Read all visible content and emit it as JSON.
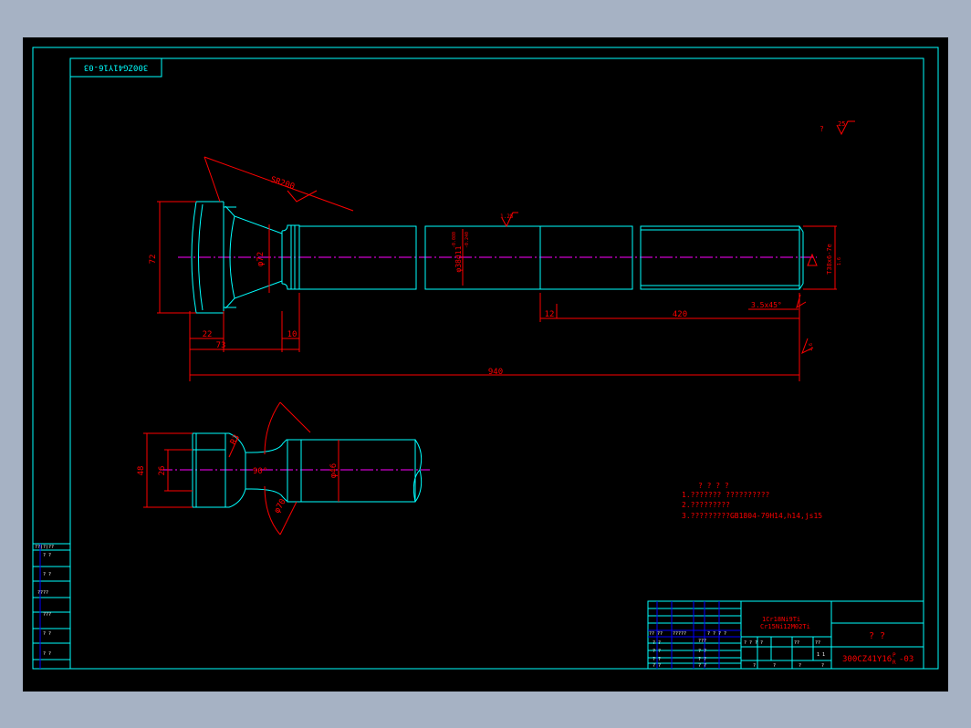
{
  "colors": {
    "outline": "#00ffff",
    "dimension": "#ff0000",
    "centerline": "#ff00ff",
    "note": "#ff0000",
    "text": "#ffffff",
    "border_blue": "#0000ff"
  },
  "drawing": {
    "code_box": "300ZG41Y16-03",
    "roughness_general": "25",
    "roughness_general_prefix": "?",
    "dims": {
      "sr200": "SR200",
      "d72_head": "72",
      "phi72": "φ72",
      "d22": "22",
      "d73": "73",
      "d10": "10",
      "d940": "940",
      "d12": "12",
      "d420": "420",
      "chamfer": "3.5x45°",
      "phi38": "φ38d11",
      "tol_upper": "-0.080",
      "tol_lower": "-0.240",
      "thread": "T38x6-7e",
      "rough_160": "1.25",
      "rough_small_a": "1.6",
      "rough_small_b": "1.6",
      "d48": "48",
      "d26": "26",
      "r3": "R3",
      "angle90": "90°",
      "phi46": "φ46",
      "phi70": "φ70"
    },
    "notes_title": "? ? ? ?",
    "notes": [
      "1.??????? ??????????",
      "2.?????????",
      "3.?????????GB1804-79H14,h14,js15"
    ]
  },
  "left_panel": {
    "rows": [
      "??(?)??",
      "? ?",
      "? ?",
      "????",
      "???",
      "? ?",
      "? ?"
    ]
  },
  "title_block": {
    "material_line1": "1Cr18Ni9Ti",
    "material_line2": "Cr15Ni12M02Ti",
    "name": "?   ?",
    "code": "300CZ41Y16",
    "code_suffix_top": "P",
    "code_suffix_bottom": "R",
    "code_dash": "-03",
    "small_labels": [
      "?? ??",
      "?????",
      "? ? ? ?",
      "???",
      "? ? ? ?",
      "??",
      "??",
      "??",
      "? ?",
      "? ?",
      "? ?",
      "? ?",
      "? ?",
      "? ?",
      "? ?",
      "1 1",
      "?",
      "?",
      "?",
      "?"
    ]
  }
}
